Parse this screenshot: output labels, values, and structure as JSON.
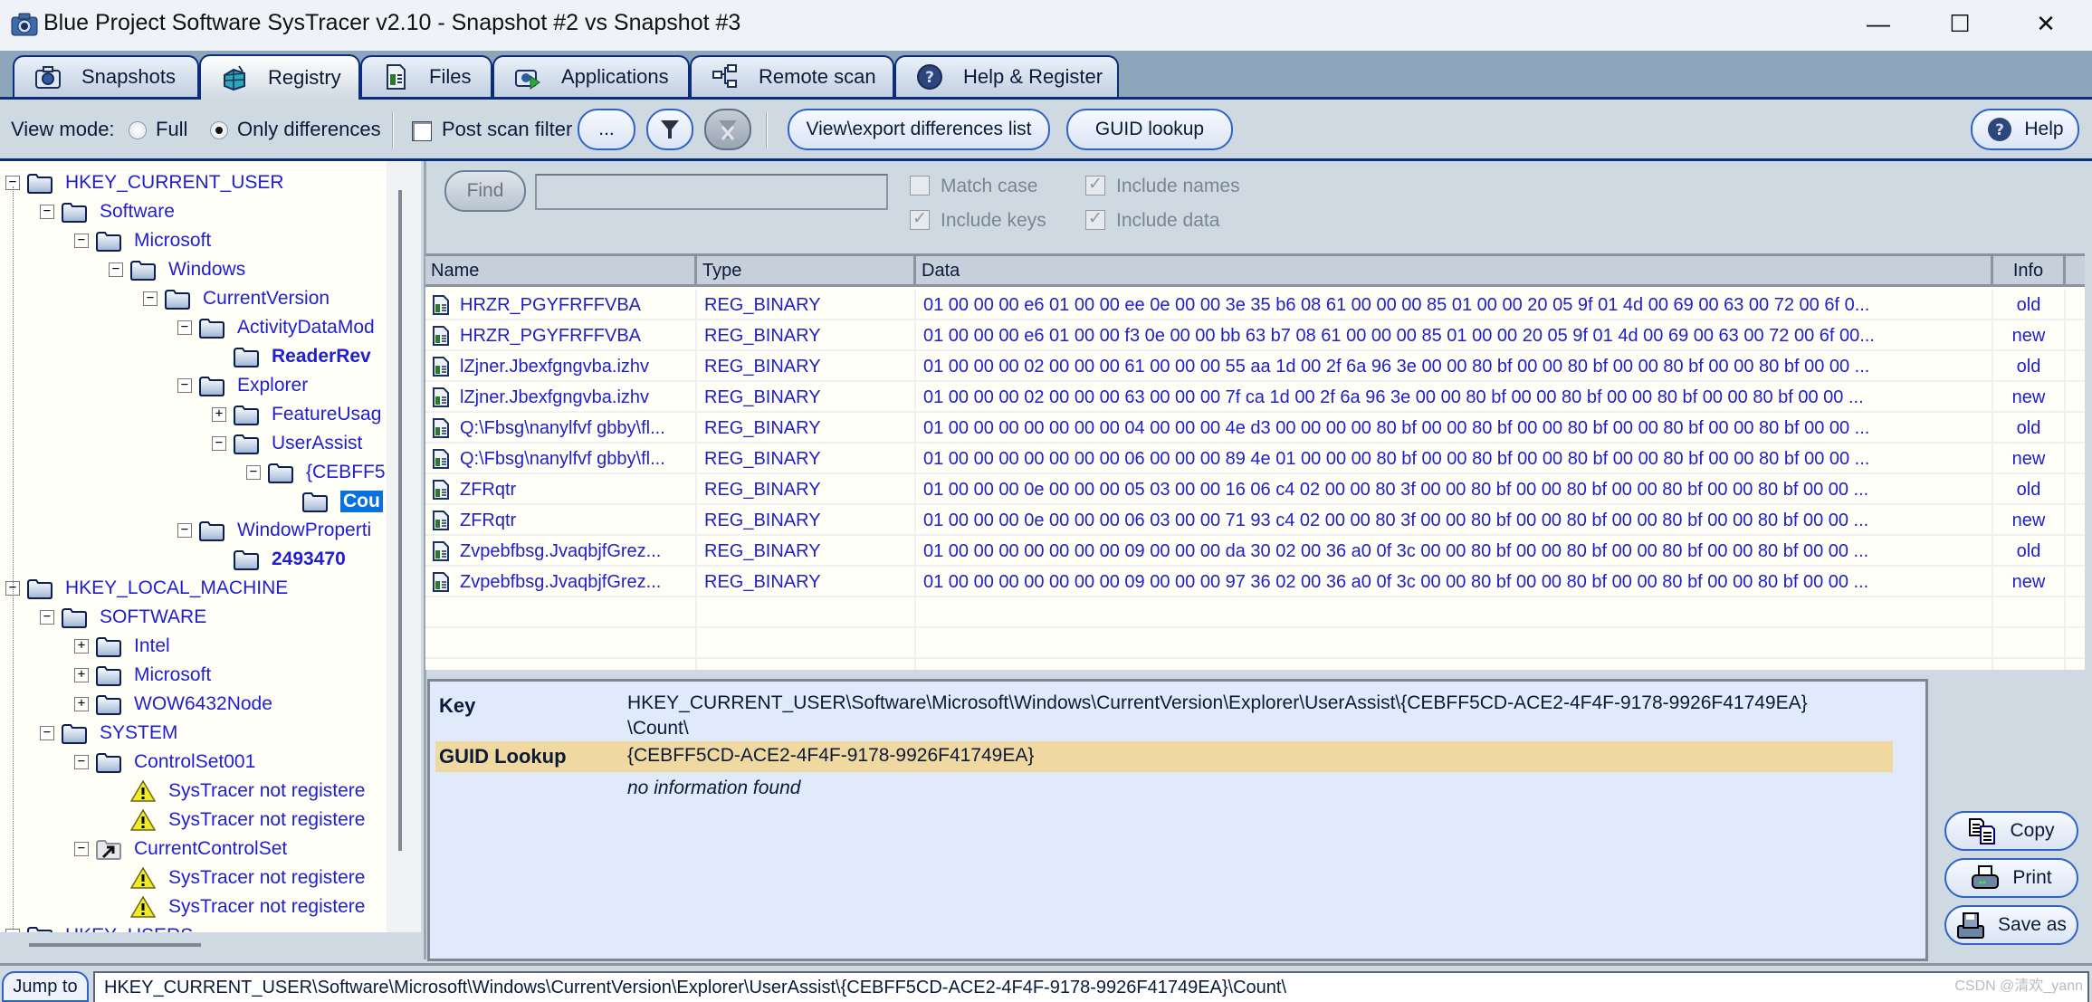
{
  "window": {
    "title": "Blue Project Software SysTracer v2.10 - Snapshot #2 vs Snapshot #3",
    "controls": {
      "minimize": "—",
      "maximize": "☐",
      "close": "✕"
    }
  },
  "tabs": [
    {
      "label": "Snapshots",
      "icon": "camera-icon",
      "active": false
    },
    {
      "label": "Registry",
      "icon": "registry-icon",
      "active": true
    },
    {
      "label": "Files",
      "icon": "file-icon",
      "active": false
    },
    {
      "label": "Applications",
      "icon": "application-icon",
      "active": false
    },
    {
      "label": "Remote scan",
      "icon": "network-icon",
      "active": false
    },
    {
      "label": "Help & Register",
      "icon": "help-icon",
      "active": false
    }
  ],
  "toolbar": {
    "view_mode_label": "View mode:",
    "view_mode_options": [
      {
        "label": "Full",
        "checked": false
      },
      {
        "label": "Only differences",
        "checked": true
      }
    ],
    "post_scan_filter_label": "Post scan filter",
    "post_scan_filter_checked": false,
    "ellipsis_button": "...",
    "view_export_button": "View\\export differences list",
    "guid_lookup_button": "GUID lookup",
    "help_button": "Help"
  },
  "tree": {
    "nodes": [
      {
        "label": "HKEY_CURRENT_USER",
        "depth": 0,
        "expander": "minus",
        "icon": "folder",
        "bold": false
      },
      {
        "label": "Software",
        "depth": 1,
        "expander": "minus",
        "icon": "folder",
        "bold": false
      },
      {
        "label": "Microsoft",
        "depth": 2,
        "expander": "minus",
        "icon": "folder",
        "bold": false
      },
      {
        "label": "Windows",
        "depth": 3,
        "expander": "minus",
        "icon": "folder",
        "bold": false
      },
      {
        "label": "CurrentVersion",
        "depth": 4,
        "expander": "minus",
        "icon": "folder",
        "bold": false
      },
      {
        "label": "ActivityDataMod",
        "depth": 5,
        "expander": "minus",
        "icon": "folder",
        "bold": false
      },
      {
        "label": "ReaderRev",
        "depth": 6,
        "expander": "none",
        "icon": "folder",
        "bold": true
      },
      {
        "label": "Explorer",
        "depth": 5,
        "expander": "minus",
        "icon": "folder",
        "bold": false
      },
      {
        "label": "FeatureUsag",
        "depth": 6,
        "expander": "plus",
        "icon": "folder",
        "bold": false
      },
      {
        "label": "UserAssist",
        "depth": 6,
        "expander": "minus",
        "icon": "folder",
        "bold": false
      },
      {
        "label": "{CEBFF5",
        "depth": 7,
        "expander": "minus",
        "icon": "folder",
        "bold": false
      },
      {
        "label": "Cou",
        "depth": 8,
        "expander": "none",
        "icon": "folder",
        "bold": true,
        "selected": true
      },
      {
        "label": "WindowProperti",
        "depth": 5,
        "expander": "minus",
        "icon": "folder",
        "bold": false
      },
      {
        "label": "2493470",
        "depth": 6,
        "expander": "none",
        "icon": "folder",
        "bold": true
      },
      {
        "label": "HKEY_LOCAL_MACHINE",
        "depth": 0,
        "expander": "minus",
        "icon": "folder",
        "bold": false
      },
      {
        "label": "SOFTWARE",
        "depth": 1,
        "expander": "minus",
        "icon": "folder",
        "bold": false
      },
      {
        "label": "Intel",
        "depth": 2,
        "expander": "plus",
        "icon": "folder",
        "bold": false
      },
      {
        "label": "Microsoft",
        "depth": 2,
        "expander": "plus",
        "icon": "folder",
        "bold": false
      },
      {
        "label": "WOW6432Node",
        "depth": 2,
        "expander": "plus",
        "icon": "folder",
        "bold": false
      },
      {
        "label": "SYSTEM",
        "depth": 1,
        "expander": "minus",
        "icon": "folder",
        "bold": false
      },
      {
        "label": "ControlSet001",
        "depth": 2,
        "expander": "minus",
        "icon": "folder",
        "bold": false
      },
      {
        "label": "SysTracer not registere",
        "depth": 3,
        "expander": "none",
        "icon": "warning",
        "bold": false
      },
      {
        "label": "SysTracer not registere",
        "depth": 3,
        "expander": "none",
        "icon": "warning",
        "bold": false
      },
      {
        "label": "CurrentControlSet",
        "depth": 2,
        "expander": "minus",
        "icon": "shortcut",
        "bold": false
      },
      {
        "label": "SysTracer not registere",
        "depth": 3,
        "expander": "none",
        "icon": "warning",
        "bold": false
      },
      {
        "label": "SysTracer not registere",
        "depth": 3,
        "expander": "none",
        "icon": "warning",
        "bold": false
      },
      {
        "label": "HKEY_USERS",
        "depth": 0,
        "expander": "minus",
        "icon": "folder",
        "bold": false
      }
    ]
  },
  "find": {
    "button": "Find",
    "input_value": "",
    "options": [
      {
        "label": "Match case",
        "checked": false
      },
      {
        "label": "Include names",
        "checked": true
      },
      {
        "label": "Include keys",
        "checked": true
      },
      {
        "label": "Include data",
        "checked": true
      }
    ]
  },
  "table": {
    "columns": [
      "Name",
      "Type",
      "Data",
      "Info"
    ],
    "rows": [
      {
        "name": "HRZR_PGYFRFFVBA",
        "type": "REG_BINARY",
        "data": "01 00 00 00 e6 01 00 00 ee 0e 00 00 3e 35 b6 08 61 00 00 00 85 01 00 00 20 05 9f 01 4d 00 69 00 63 00 72 00 6f 0...",
        "info": "old"
      },
      {
        "name": "HRZR_PGYFRFFVBA",
        "type": "REG_BINARY",
        "data": "01 00 00 00 e6 01 00 00 f3 0e 00 00 bb 63 b7 08 61 00 00 00 85 01 00 00 20 05 9f 01 4d 00 69 00 63 00 72 00 6f 00...",
        "info": "new"
      },
      {
        "name": "lZjner.Jbexfgngvba.izhv",
        "type": "REG_BINARY",
        "data": "01 00 00 00 02 00 00 00 61 00 00 00 55 aa 1d 00 2f 6a 96 3e 00 00 80 bf 00 00 80 bf 00 00 80 bf 00 00 80 bf 00 00 ...",
        "info": "old"
      },
      {
        "name": "lZjner.Jbexfgngvba.izhv",
        "type": "REG_BINARY",
        "data": "01 00 00 00 02 00 00 00 63 00 00 00 7f ca 1d 00 2f 6a 96 3e 00 00 80 bf 00 00 80 bf 00 00 80 bf 00 00 80 bf 00 00 ...",
        "info": "new"
      },
      {
        "name": "Q:\\Fbsg\\nanylfvf gbby\\fl...",
        "type": "REG_BINARY",
        "data": "01 00 00 00 00 00 00 00 04 00 00 00 4e d3 00 00 00 00 80 bf 00 00 80 bf 00 00 80 bf 00 00 80 bf 00 00 80 bf 00 00 ...",
        "info": "old"
      },
      {
        "name": "Q:\\Fbsg\\nanylfvf gbby\\fl...",
        "type": "REG_BINARY",
        "data": "01 00 00 00 00 00 00 00 06 00 00 00 89 4e 01 00 00 00 80 bf 00 00 80 bf 00 00 80 bf 00 00 80 bf 00 00 80 bf 00 00 ...",
        "info": "new"
      },
      {
        "name": "ZFRqtr",
        "type": "REG_BINARY",
        "data": "01 00 00 00 0e 00 00 00 05 03 00 00 16 06 c4 02 00 00 80 3f 00 00 80 bf 00 00 80 bf 00 00 80 bf 00 00 80 bf 00 00 ...",
        "info": "old"
      },
      {
        "name": "ZFRqtr",
        "type": "REG_BINARY",
        "data": "01 00 00 00 0e 00 00 00 06 03 00 00 71 93 c4 02 00 00 80 3f 00 00 80 bf 00 00 80 bf 00 00 80 bf 00 00 80 bf 00 00 ...",
        "info": "new"
      },
      {
        "name": "Zvpebfbsg.JvaqbjfGrez...",
        "type": "REG_BINARY",
        "data": "01 00 00 00 00 00 00 00 09 00 00 00 da 30 02 00 36 a0 0f 3c 00 00 80 bf 00 00 80 bf 00 00 80 bf 00 00 80 bf 00 00 ...",
        "info": "old"
      },
      {
        "name": "Zvpebfbsg.JvaqbjfGrez...",
        "type": "REG_BINARY",
        "data": "01 00 00 00 00 00 00 00 09 00 00 00 97 36 02 00 36 a0 0f 3c 00 00 80 bf 00 00 80 bf 00 00 80 bf 00 00 80 bf 00 00 ...",
        "info": "new"
      }
    ]
  },
  "detail": {
    "key_label": "Key",
    "key_value_line1": "HKEY_CURRENT_USER\\Software\\Microsoft\\Windows\\CurrentVersion\\Explorer\\UserAssist\\{CEBFF5CD-ACE2-4F4F-9178-9926F41749EA}",
    "key_value_line2": "\\Count\\",
    "guid_label": "GUID Lookup",
    "guid_value": "{CEBFF5CD-ACE2-4F4F-9178-9926F41749EA}",
    "guid_result": "no information found",
    "guid_highlight_color": "#f0d9a0"
  },
  "side_buttons": {
    "copy": "Copy",
    "print": "Print",
    "save_as": "Save as"
  },
  "jumpbar": {
    "button": "Jump to",
    "value": "HKEY_CURRENT_USER\\Software\\Microsoft\\Windows\\CurrentVersion\\Explorer\\UserAssist\\{CEBFF5CD-ACE2-4F4F-9178-9926F41749EA}\\Count\\"
  },
  "watermark": "CSDN @清欢_yann",
  "colors": {
    "accent_dark_blue": "#0b2d7a",
    "tree_text": "#1f1fd0",
    "selection": "#0a6fdf",
    "toolbar_bg": "#cfd9e2",
    "tabstrip_bg": "#8ea6bc"
  }
}
